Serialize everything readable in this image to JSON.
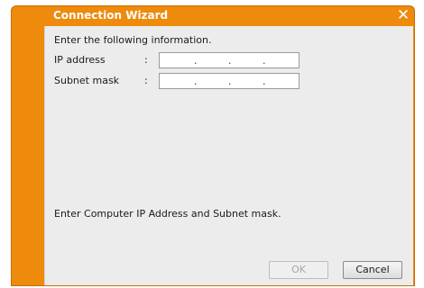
{
  "window": {
    "title": "Connection Wizard",
    "close_glyph": "✕",
    "accent_color": "#ee8a0c"
  },
  "form": {
    "instruction": "Enter the following information.",
    "colon": ":",
    "ip_address": {
      "label": "IP address",
      "value": "",
      "separator": "."
    },
    "subnet_mask": {
      "label": "Subnet mask",
      "value": "",
      "separator": "."
    }
  },
  "status": {
    "message": "Enter Computer IP Address and Subnet mask."
  },
  "buttons": {
    "ok": {
      "label": "OK",
      "enabled": false
    },
    "cancel": {
      "label": "Cancel",
      "enabled": true
    }
  },
  "icons": {
    "close": "close-icon"
  }
}
